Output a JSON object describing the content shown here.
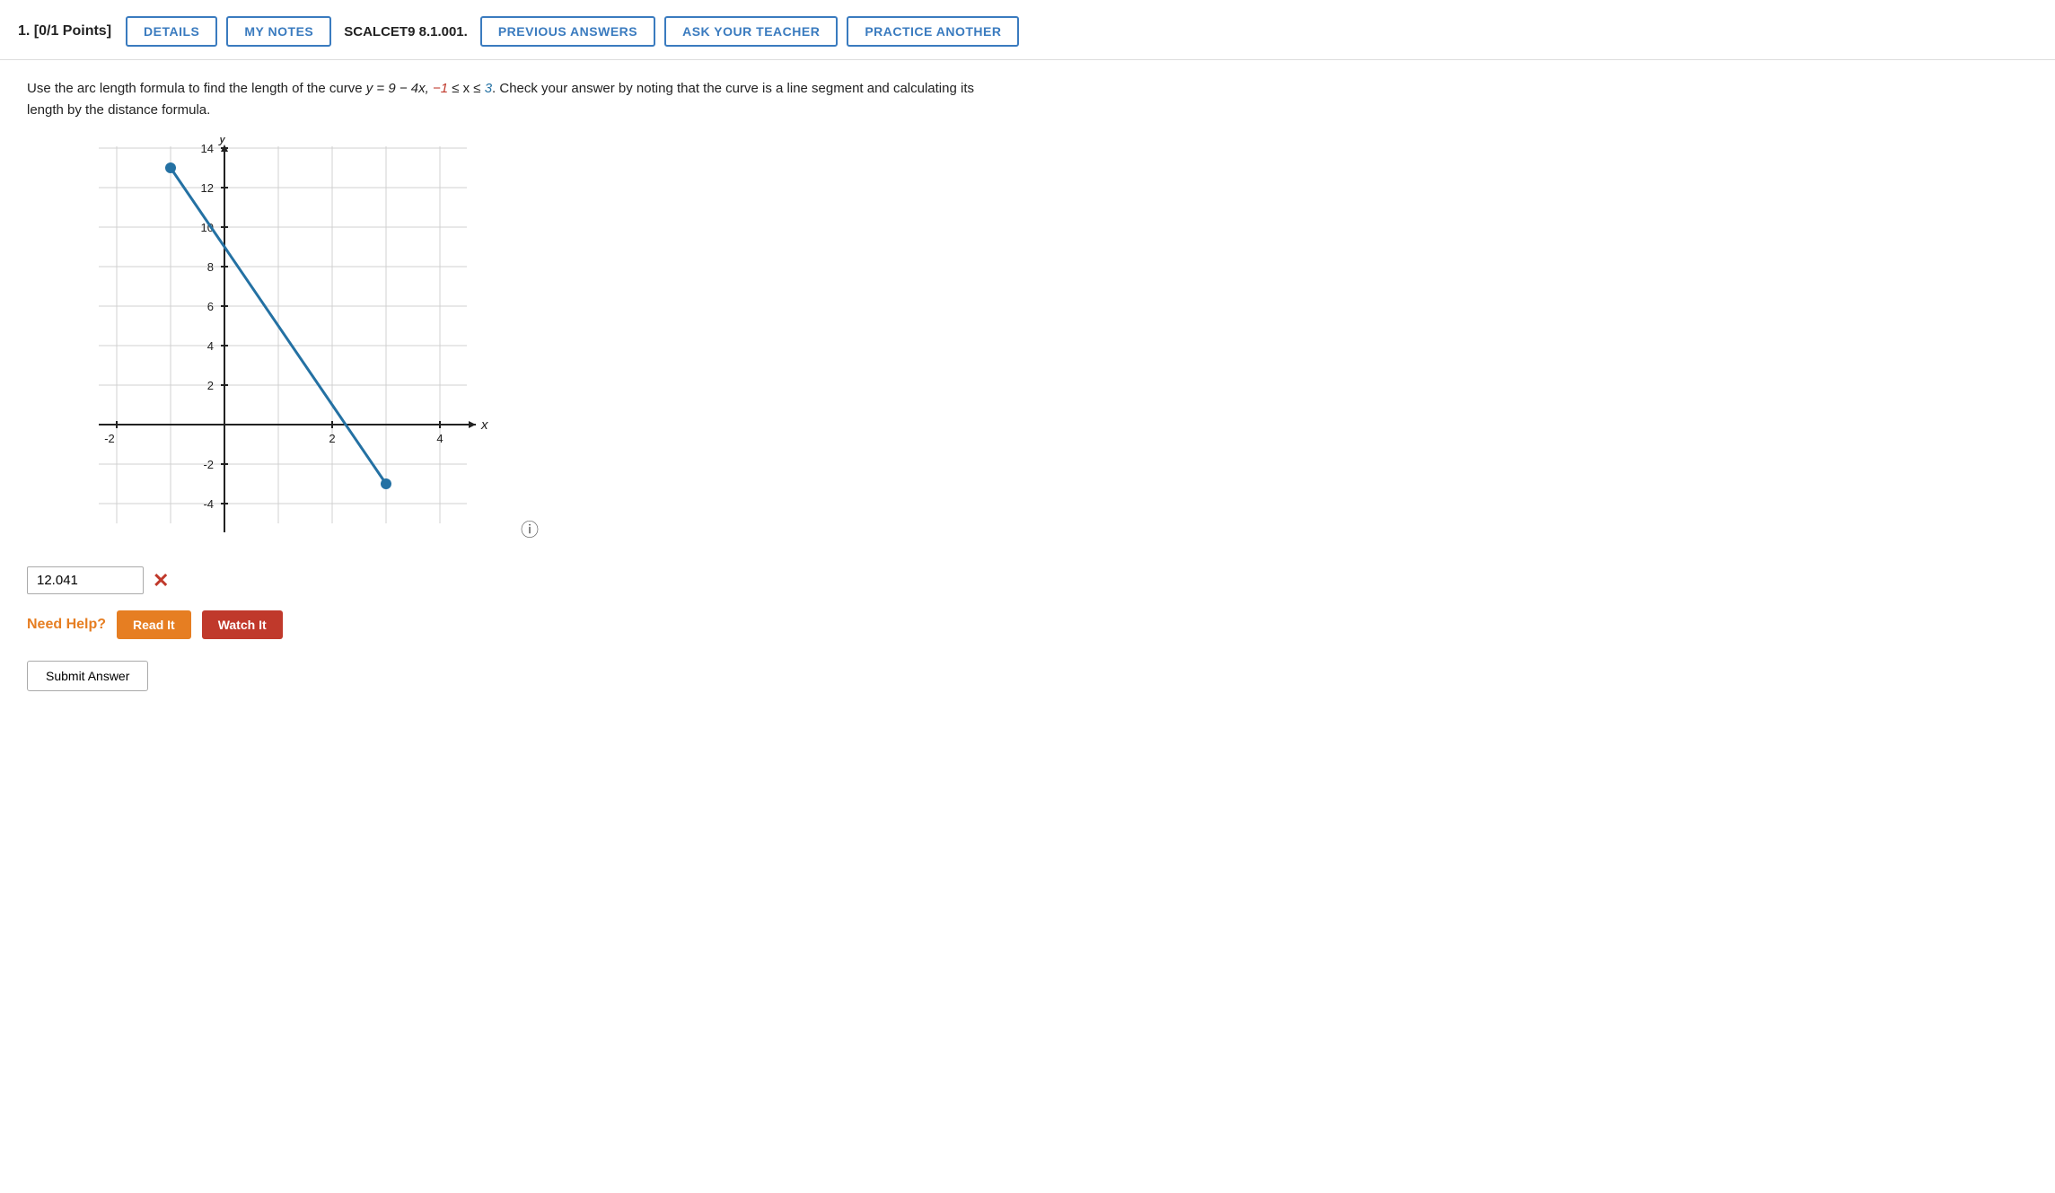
{
  "header": {
    "problem_label": "1.  [0/1 Points]",
    "details_btn": "DETAILS",
    "my_notes_btn": "MY NOTES",
    "scalcet_label": "SCALCET9 8.1.001.",
    "previous_answers_btn": "PREVIOUS ANSWERS",
    "ask_teacher_btn": "ASK YOUR TEACHER",
    "practice_another_btn": "PRACTICE ANOTHER"
  },
  "problem": {
    "text_part1": "Use the arc length formula to find the length of the curve ",
    "equation": "y = 9 − 4x,",
    "text_part2": " ",
    "range_red1": "−1",
    "text_part3": " ≤ x ≤ ",
    "range_blue": "3",
    "text_part4": ". Check your answer by noting that the curve is a line segment and calculating its length by the distance formula."
  },
  "graph": {
    "x_label": "x",
    "y_label": "y",
    "x_ticks": [
      "-2",
      "2",
      "4"
    ],
    "y_ticks": [
      "-4",
      "-2",
      "2",
      "4",
      "6",
      "8",
      "10",
      "12",
      "14"
    ],
    "info_icon": "ⓘ"
  },
  "answer": {
    "value": "12.041",
    "placeholder": "",
    "wrong_icon": "✕"
  },
  "help": {
    "need_help_label": "Need Help?",
    "read_it_btn": "Read It",
    "watch_it_btn": "Watch It"
  },
  "submit": {
    "submit_btn": "Submit Answer"
  }
}
